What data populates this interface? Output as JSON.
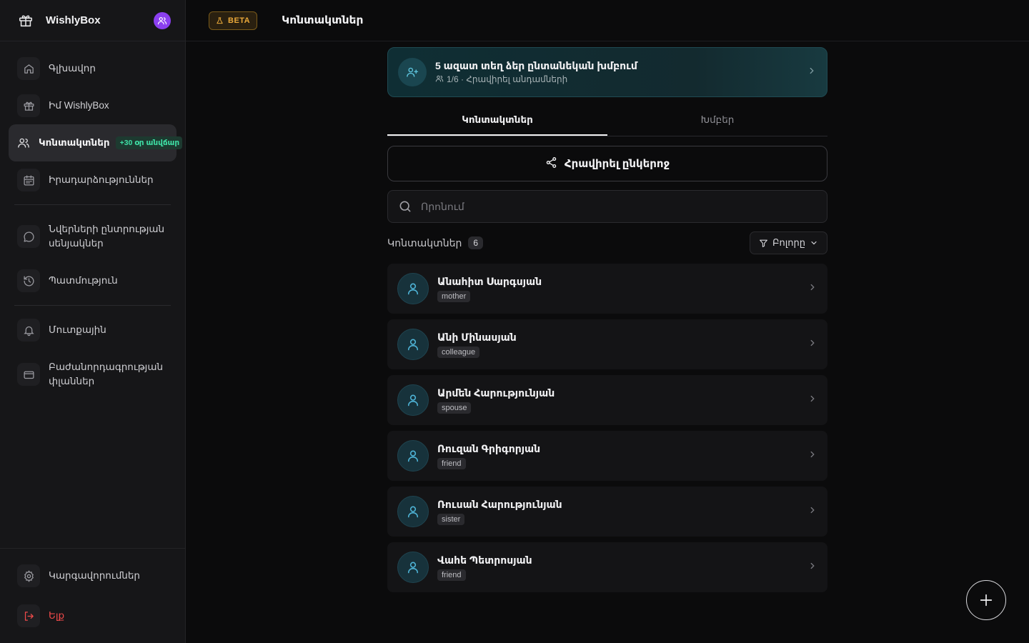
{
  "app": {
    "name": "WishlyBox"
  },
  "header": {
    "beta_label": "BETA",
    "title": "Կոնտակտներ"
  },
  "sidebar": {
    "items": [
      {
        "label": "Գլխավոր",
        "icon": "home-icon"
      },
      {
        "label": "Իմ WishlyBox",
        "icon": "gift-icon"
      },
      {
        "label": "Կոնտակտներ",
        "icon": "users-icon",
        "badge": "+30 օր անվճար",
        "active": true
      },
      {
        "label": "Իրադարձություններ",
        "icon": "calendar-icon"
      },
      {
        "label": "Նվերների ընտրության սենյակներ",
        "icon": "chat-icon"
      },
      {
        "label": "Պատմություն",
        "icon": "history-icon"
      },
      {
        "label": "Մուտքային",
        "icon": "bell-icon"
      },
      {
        "label": "Բաժանորդագրության փլաններ",
        "icon": "card-icon"
      }
    ],
    "bottom": [
      {
        "label": "Կարգավորումներ",
        "icon": "gear-icon"
      },
      {
        "label": "Ելք",
        "icon": "logout-icon"
      }
    ]
  },
  "banner": {
    "title": "5 ազատ տեղ ձեր ընտանեկան խմբում",
    "subtitle": "1/6 · Հրավիրել անդամների"
  },
  "tabs": [
    {
      "label": "Կոնտակտներ",
      "active": true
    },
    {
      "label": "Խմբեր"
    }
  ],
  "invite_label": "Հրավիրել ընկերոջ",
  "search": {
    "placeholder": "Որոնում"
  },
  "list": {
    "title": "Կոնտակտներ",
    "count": "6",
    "filter_label": "Բոլորը"
  },
  "contacts": [
    {
      "name": "Անահիտ Սարգսյան",
      "relation": "mother"
    },
    {
      "name": "Անի Մինասյան",
      "relation": "colleague"
    },
    {
      "name": "Արմեն Հարությունյան",
      "relation": "spouse"
    },
    {
      "name": "Ռուզան Գրիգորյան",
      "relation": "friend"
    },
    {
      "name": "Ռուսան Հարությունյան",
      "relation": "sister"
    },
    {
      "name": "Վահե Պետրոսյան",
      "relation": "friend"
    }
  ],
  "colors": {
    "accent_purple": "#8b3ff0",
    "promo_green": "#3fe0a6",
    "beta_amber": "#e9a83a",
    "danger": "#ef4a4a",
    "avatar_blue": "#4fb5d8"
  }
}
